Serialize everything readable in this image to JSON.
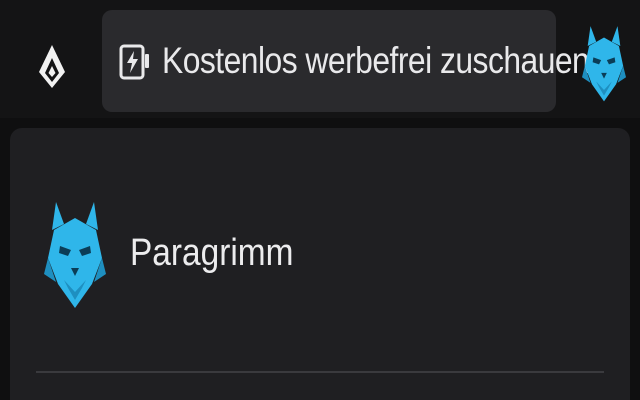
{
  "header": {
    "logo_icon": "diamond-logo-icon",
    "promo": {
      "icon": "battery-bolt-icon",
      "label": "Kostenlos werbefrei zuschauen"
    },
    "avatar_icon": "lynx-avatar-icon"
  },
  "menu": {
    "profile": {
      "avatar_icon": "lynx-avatar-icon",
      "name": "Paragrimm"
    }
  },
  "colors": {
    "background": "#0f0f10",
    "topbar": "#141415",
    "promo_bg": "#2a2a2d",
    "menu_bg": "#1f1f22",
    "avatar_accent": "#2fb6ea",
    "text": "#e9e9eb"
  }
}
